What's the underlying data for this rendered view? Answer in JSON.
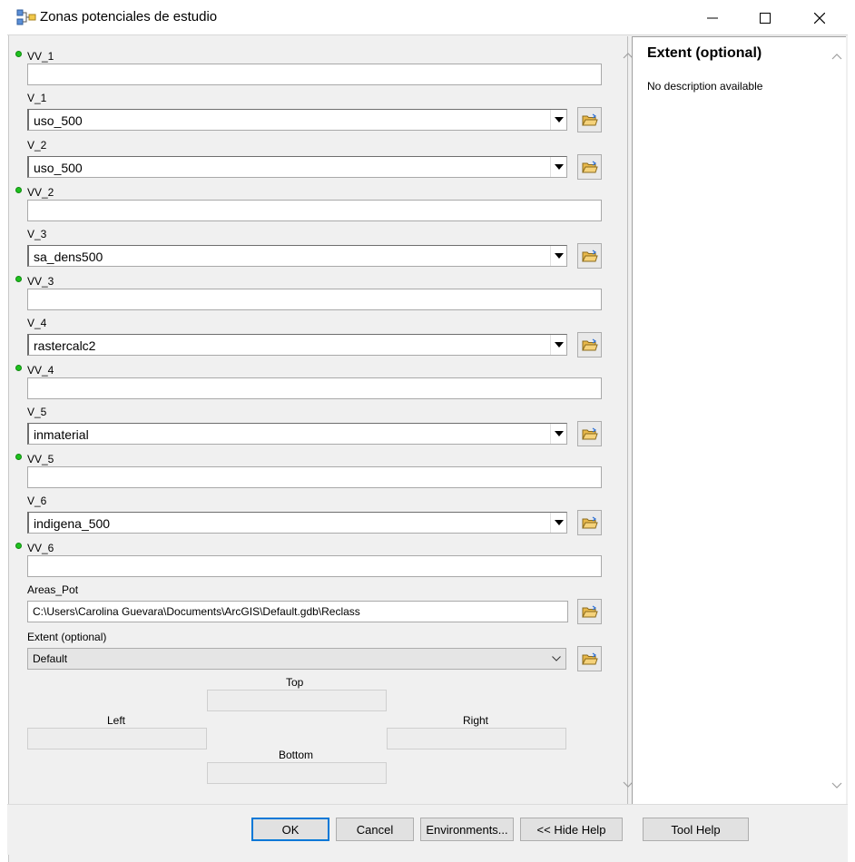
{
  "window": {
    "title": "Zonas potenciales de estudio"
  },
  "form": {
    "vv1": {
      "label": "VV_1",
      "value": ""
    },
    "v1": {
      "label": "V_1",
      "value": "uso_500"
    },
    "v2": {
      "label": "V_2",
      "value": "uso_500"
    },
    "vv2": {
      "label": "VV_2",
      "value": ""
    },
    "v3": {
      "label": "V_3",
      "value": "sa_dens500"
    },
    "vv3": {
      "label": "VV_3",
      "value": ""
    },
    "v4": {
      "label": "V_4",
      "value": "rastercalc2"
    },
    "vv4": {
      "label": "VV_4",
      "value": ""
    },
    "v5": {
      "label": "V_5",
      "value": "inmaterial"
    },
    "vv5": {
      "label": "VV_5",
      "value": ""
    },
    "v6": {
      "label": "V_6",
      "value": "indigena_500"
    },
    "vv6": {
      "label": "VV_6",
      "value": ""
    },
    "areas": {
      "label": "Areas_Pot",
      "value": "C:\\Users\\Carolina Guevara\\Documents\\ArcGIS\\Default.gdb\\Reclass"
    },
    "extent": {
      "label": "Extent (optional)",
      "value": "Default",
      "top_label": "Top",
      "left_label": "Left",
      "right_label": "Right",
      "bottom_label": "Bottom"
    }
  },
  "help": {
    "title": "Extent (optional)",
    "description": "No description available"
  },
  "buttons": {
    "ok": "OK",
    "cancel": "Cancel",
    "environments": "Environments...",
    "hide_help": "<< Hide Help",
    "tool_help": "Tool Help"
  },
  "colors": {
    "required_dot": "#1ec11e",
    "default_button_border": "#0078d7"
  }
}
